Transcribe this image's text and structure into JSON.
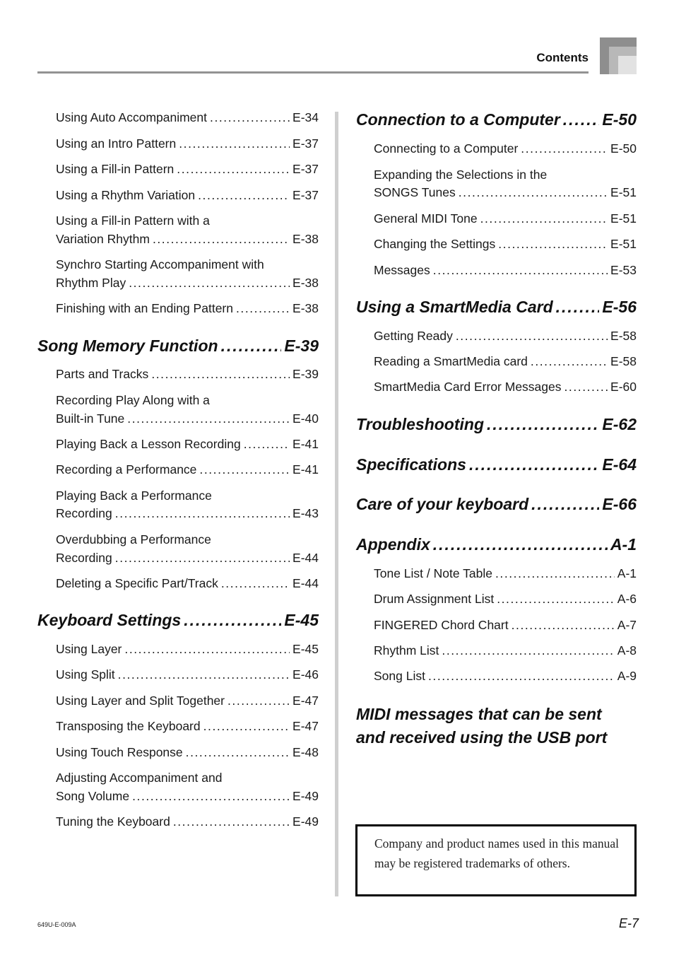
{
  "header": {
    "title": "Contents"
  },
  "left_column": {
    "intro_items": [
      {
        "title": "Using Auto Accompaniment",
        "page": "E-34"
      },
      {
        "title": "Using an Intro Pattern",
        "page": "E-37"
      },
      {
        "title": "Using a Fill-in Pattern",
        "page": "E-37"
      },
      {
        "title": "Using a Rhythm Variation",
        "page": "E-37"
      },
      {
        "title_line1": "Using a Fill-in Pattern with a",
        "title": "Variation Rhythm",
        "page": "E-38"
      },
      {
        "title_line1": "Synchro Starting Accompaniment with",
        "title": "Rhythm Play",
        "page": "E-38"
      },
      {
        "title": "Finishing with an Ending Pattern",
        "page": "E-38"
      }
    ],
    "sections": [
      {
        "title": "Song Memory Function",
        "page": "E-39",
        "items": [
          {
            "title": "Parts and Tracks",
            "page": "E-39"
          },
          {
            "title_line1": "Recording Play Along with a",
            "title": "Built-in Tune",
            "page": "E-40"
          },
          {
            "title": "Playing Back a Lesson Recording",
            "page": "E-41"
          },
          {
            "title": "Recording a Performance",
            "page": "E-41"
          },
          {
            "title_line1": "Playing Back a Performance",
            "title": "Recording",
            "page": "E-43"
          },
          {
            "title_line1": "Overdubbing a Performance",
            "title": "Recording",
            "page": "E-44"
          },
          {
            "title": "Deleting a Specific Part/Track",
            "page": "E-44"
          }
        ]
      },
      {
        "title": "Keyboard Settings",
        "page": "E-45",
        "items": [
          {
            "title": "Using Layer",
            "page": "E-45"
          },
          {
            "title": "Using Split",
            "page": "E-46"
          },
          {
            "title": "Using Layer and Split Together",
            "page": "E-47"
          },
          {
            "title": "Transposing the Keyboard",
            "page": "E-47"
          },
          {
            "title": "Using Touch Response",
            "page": "E-48"
          },
          {
            "title_line1": "Adjusting Accompaniment and",
            "title": "Song Volume",
            "page": "E-49"
          },
          {
            "title": "Tuning the Keyboard",
            "page": "E-49"
          }
        ]
      }
    ]
  },
  "right_column": {
    "sections": [
      {
        "title": "Connection to a Computer",
        "page": "E-50",
        "items": [
          {
            "title": "Connecting to a Computer",
            "page": "E-50"
          },
          {
            "title_line1": "Expanding the Selections in the",
            "title": "SONGS Tunes",
            "page": "E-51"
          },
          {
            "title": "General MIDI Tone",
            "page": "E-51"
          },
          {
            "title": "Changing the Settings",
            "page": "E-51"
          },
          {
            "title": "Messages",
            "page": "E-53"
          }
        ]
      },
      {
        "title": "Using a SmartMedia Card",
        "page": "E-56",
        "items": [
          {
            "title": "Getting Ready",
            "page": "E-58"
          },
          {
            "title": "Reading a SmartMedia card",
            "page": "E-58"
          },
          {
            "title": "SmartMedia Card Error Messages",
            "page": "E-60"
          }
        ]
      },
      {
        "title": "Troubleshooting",
        "page": "E-62",
        "items": []
      },
      {
        "title": "Specifications",
        "page": "E-64",
        "items": []
      },
      {
        "title": "Care of your keyboard",
        "page": "E-66",
        "items": []
      },
      {
        "title": "Appendix",
        "page": "A-1",
        "items": [
          {
            "title": "Tone List / Note Table",
            "page": "A-1"
          },
          {
            "title": "Drum Assignment List",
            "page": "A-6"
          },
          {
            "title": "FINGERED Chord Chart",
            "page": "A-7"
          },
          {
            "title": "Rhythm List",
            "page": "A-8"
          },
          {
            "title": "Song List",
            "page": "A-9"
          }
        ]
      },
      {
        "title_line1": "MIDI messages that can be sent",
        "title_line2": "and received using the USB port"
      }
    ]
  },
  "notice": {
    "text": "Company and product names used in this manual may be registered trademarks of others."
  },
  "footer": {
    "doc_code": "649U-E-009A",
    "page_number": "E-7"
  }
}
